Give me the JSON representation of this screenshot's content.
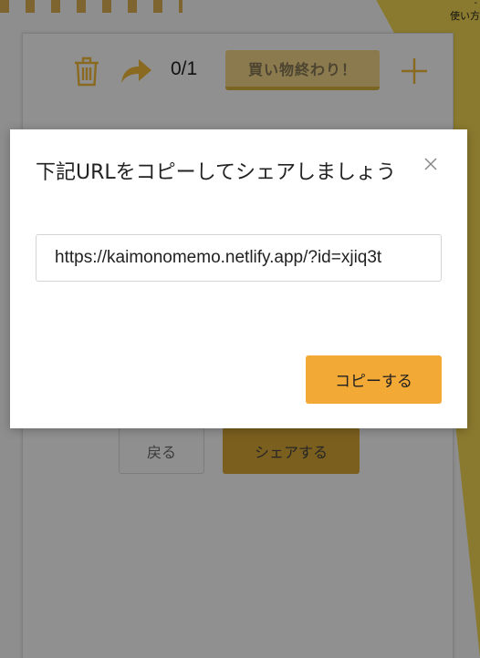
{
  "header": {
    "help_link": "使い方",
    "help_dash": "-"
  },
  "toolbar": {
    "count": "0/1",
    "finish_label": "買い物終わり！"
  },
  "actions": {
    "back_label": "戻る",
    "share_label": "シェアする"
  },
  "modal": {
    "title": "下記URLをコピーしてシェアしましょう",
    "url_value": "https://kaimonomemo.netlify.app/?id=xjiq3t",
    "copy_label": "コピーする"
  },
  "colors": {
    "accent": "#f3a935",
    "accent_dark": "#b8860b",
    "modal_bg": "#ffffff"
  },
  "icons": {
    "trash": "trash-icon",
    "share": "share-arrow-icon",
    "add": "plus-icon",
    "close": "close-icon"
  }
}
